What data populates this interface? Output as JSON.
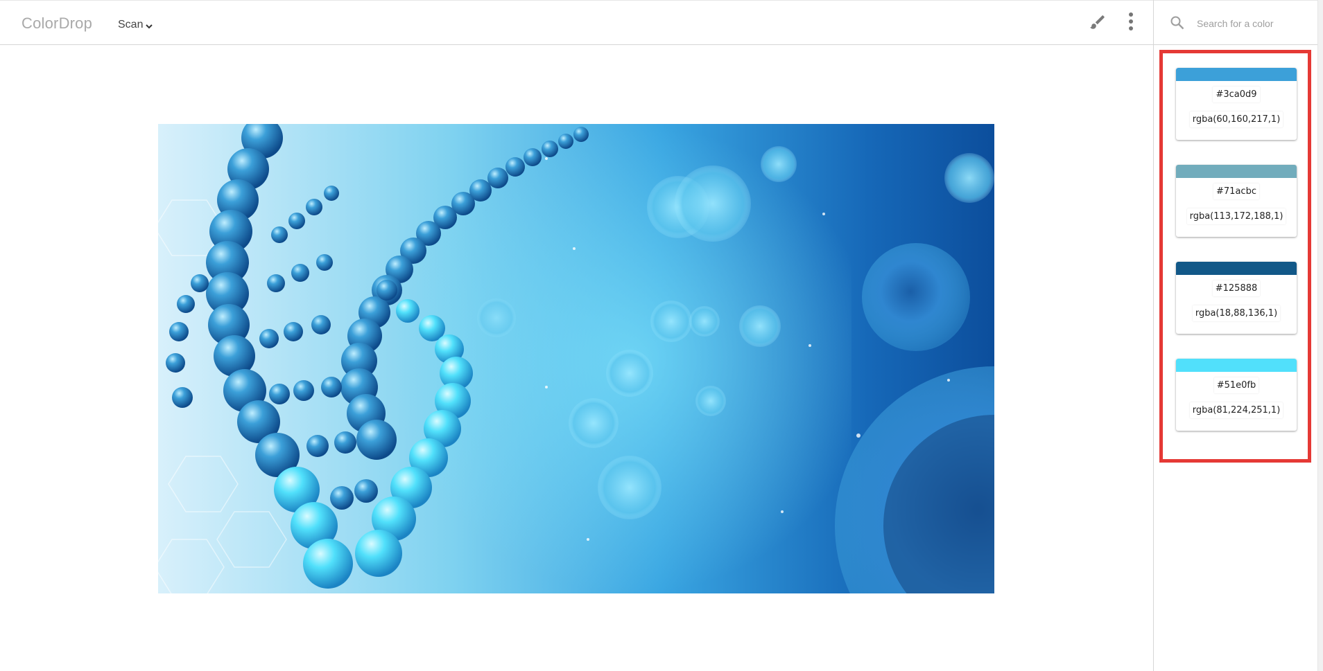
{
  "app": {
    "title": "ColorDrop"
  },
  "header": {
    "menu_label": "Scan",
    "menu_icon": "chevron-down-icon",
    "brush_icon": "brush-icon",
    "more_icon": "more-vert-icon"
  },
  "search": {
    "placeholder": "Search for a color",
    "value": ""
  },
  "palette": [
    {
      "hex": "#3ca0d9",
      "rgba": "rgba(60,160,217,1)"
    },
    {
      "hex": "#71acbc",
      "rgba": "rgba(113,172,188,1)"
    },
    {
      "hex": "#125888",
      "rgba": "rgba(18,88,136,1)"
    },
    {
      "hex": "#51e0fb",
      "rgba": "rgba(81,224,251,1)"
    }
  ],
  "colors": {
    "highlight": "#e53935",
    "logo": "#a9a9a9",
    "divider": "#d6d6d6"
  }
}
